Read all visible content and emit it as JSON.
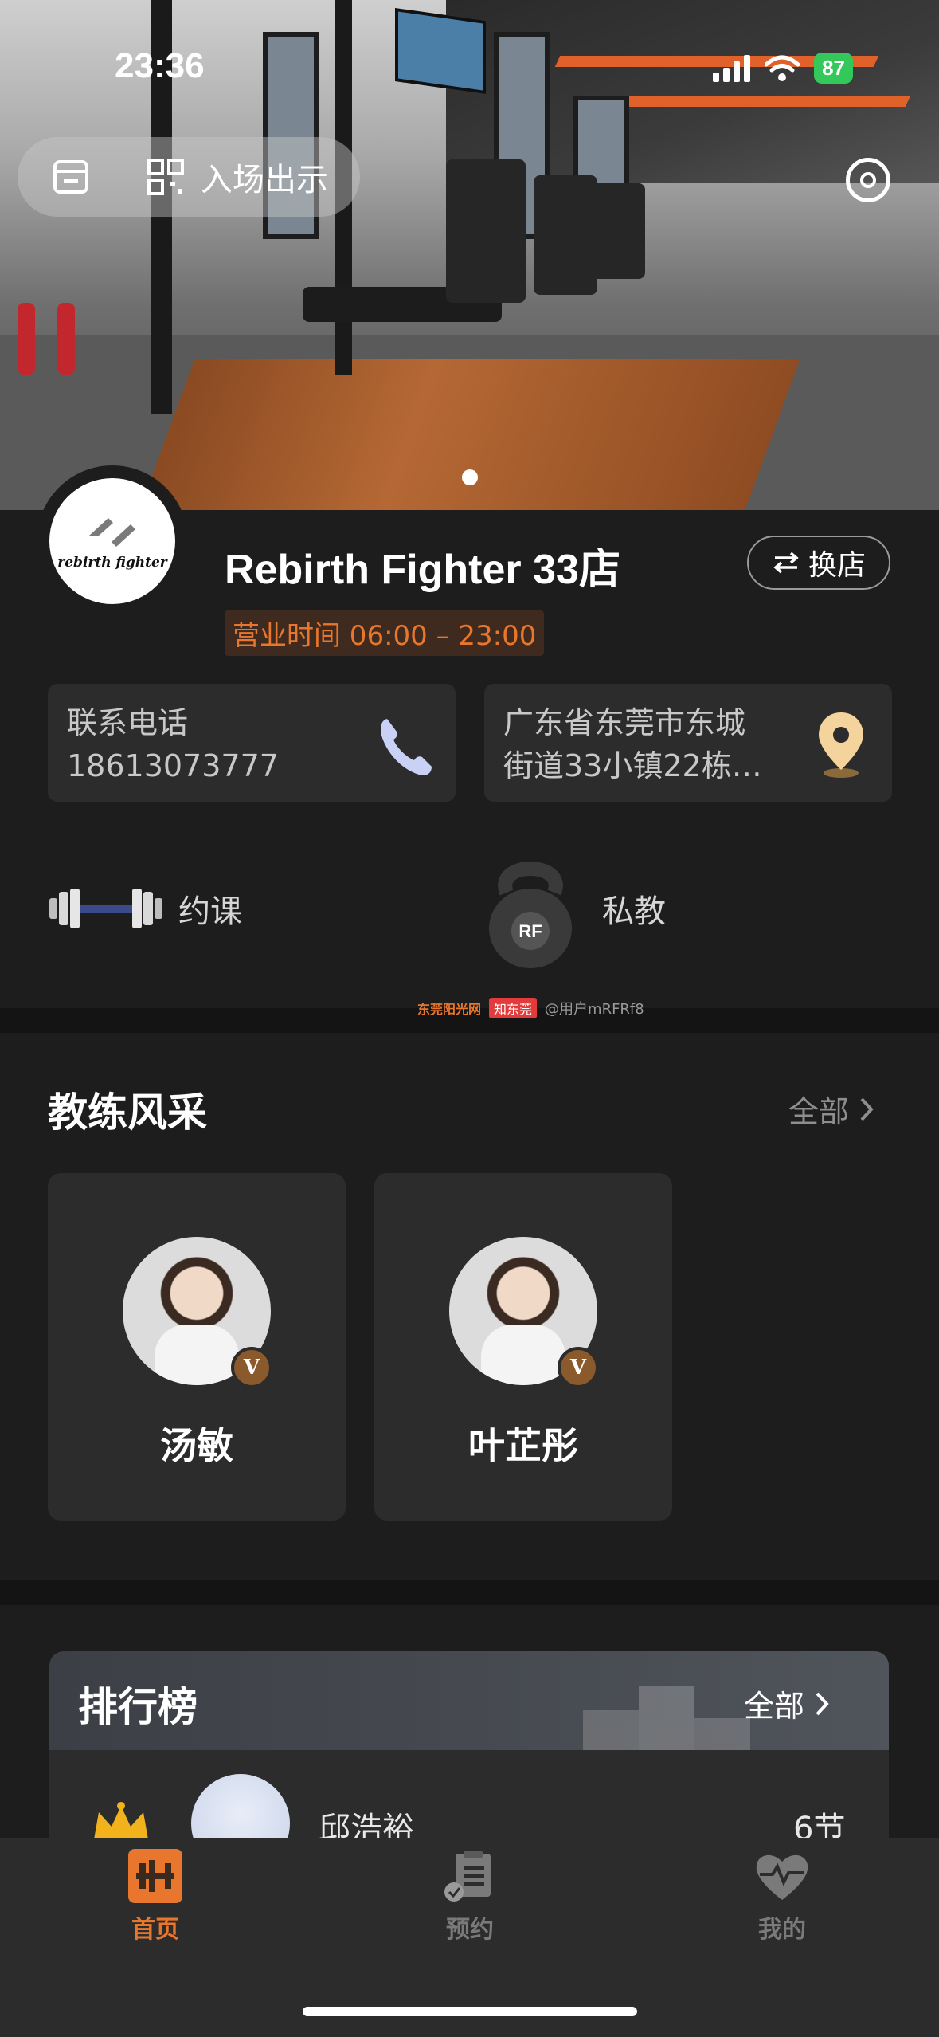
{
  "status_bar": {
    "time": "23:36",
    "battery": "87"
  },
  "hero": {
    "entry_label": "入场出示"
  },
  "store": {
    "name": "Rebirth Fighter 33店",
    "switch_label": "换店",
    "hours": "营业时间 06:00 – 23:00",
    "logo_text": "rebirth fighter",
    "phone_label": "联系电话",
    "phone_value": "18613073777",
    "address_line1": "广东省东莞市东城",
    "address_line2": "街道33小镇22栋…"
  },
  "features": [
    {
      "label": "约课",
      "icon": "dumbbell-icon"
    },
    {
      "label": "私教",
      "icon": "kettlebell-icon",
      "badge": "RF"
    }
  ],
  "watermark": {
    "site": "东莞阳光网",
    "brand": "知东莞",
    "user": "@用户mRFRf8"
  },
  "coaches": {
    "title": "教练风采",
    "see_all": "全部",
    "items": [
      {
        "name": "汤敏",
        "badge": "V"
      },
      {
        "name": "叶芷彤",
        "badge": "V"
      }
    ]
  },
  "ranking": {
    "title": "排行榜",
    "see_all": "全部",
    "rows": [
      {
        "name": "邱浩裕",
        "count": "6节"
      }
    ]
  },
  "tabs": [
    {
      "label": "首页",
      "icon": "home-barbell-icon",
      "active": true
    },
    {
      "label": "预约",
      "icon": "clipboard-icon",
      "active": false
    },
    {
      "label": "我的",
      "icon": "heart-pulse-icon",
      "active": false
    }
  ],
  "colors": {
    "accent": "#e8762c",
    "background": "#1d1d1d",
    "card": "#2c2c2c",
    "battery": "#34c759"
  }
}
